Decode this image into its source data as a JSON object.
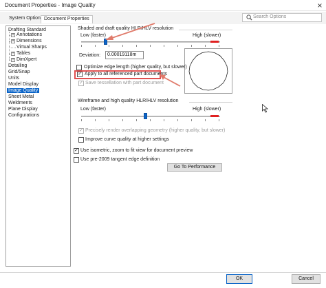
{
  "window": {
    "title": "Document Properties - Image Quality",
    "close_label": "×"
  },
  "tabs": [
    {
      "label": "System Options",
      "active": false
    },
    {
      "label": "Document Properties",
      "active": true
    }
  ],
  "search": {
    "placeholder": "Search Options",
    "icon": "magnifier-icon"
  },
  "tree": [
    {
      "label": "Drafting Standard",
      "expandable": false,
      "level": 0,
      "selected": false
    },
    {
      "label": "Annotations",
      "expandable": true,
      "level": 1,
      "selected": false
    },
    {
      "label": "Dimensions",
      "expandable": true,
      "level": 1,
      "selected": false
    },
    {
      "label": "Virtual Sharps",
      "expandable": false,
      "level": 1,
      "selected": false
    },
    {
      "label": "Tables",
      "expandable": true,
      "level": 1,
      "selected": false
    },
    {
      "label": "DimXpert",
      "expandable": true,
      "level": 1,
      "selected": false
    },
    {
      "label": "Detailing",
      "expandable": false,
      "level": 0,
      "selected": false
    },
    {
      "label": "Grid/Snap",
      "expandable": false,
      "level": 0,
      "selected": false
    },
    {
      "label": "Units",
      "expandable": false,
      "level": 0,
      "selected": false
    },
    {
      "label": "Model Display",
      "expandable": false,
      "level": 0,
      "selected": false
    },
    {
      "label": "Image Quality",
      "expandable": false,
      "level": 0,
      "selected": true
    },
    {
      "label": "Sheet Metal",
      "expandable": false,
      "level": 0,
      "selected": false
    },
    {
      "label": "Weldments",
      "expandable": false,
      "level": 0,
      "selected": false
    },
    {
      "label": "Plane Display",
      "expandable": false,
      "level": 0,
      "selected": false
    },
    {
      "label": "Configurations",
      "expandable": false,
      "level": 0,
      "selected": false
    }
  ],
  "shaded": {
    "group_label": "Shaded and draft quality HLR/HLV resolution",
    "low_label": "Low (faster)",
    "high_label": "High (slower)",
    "deviation_label": "Deviation:",
    "deviation_value": "0.00019118m",
    "optimize_label": "Optimize edge length (higher quality, but slower)",
    "optimize_checked": false,
    "apply_label": "Apply to all referenced part documents",
    "apply_checked": true,
    "save_tess_label": "Save tessellation with part document",
    "save_tess_checked": true,
    "save_tess_disabled": true,
    "slider_fraction": 0.17
  },
  "wireframe": {
    "group_label": "Wireframe and high quality HLR/HLV resolution",
    "low_label": "Low (faster)",
    "high_label": "High (slower)",
    "precise_label": "Precisely render overlapping geometry (higher quality, but slower)",
    "precise_checked": true,
    "precise_disabled": true,
    "improve_label": "Improve curve quality at higher settings",
    "improve_checked": false,
    "slider_fraction": 0.46
  },
  "options": {
    "isometric_label": "Use isometric, zoom to fit view for document preview",
    "isometric_checked": true,
    "pre2009_label": "Use pre-2009 tangent edge definition",
    "pre2009_checked": false,
    "performance_button": "Go To Performance"
  },
  "footer": {
    "ok_label": "OK",
    "cancel_label": "Cancel"
  },
  "colors": {
    "accent": "#0a64c8",
    "highlight": "#e05050",
    "arrow": "#e07a6a",
    "red_bar": "#e02020"
  }
}
